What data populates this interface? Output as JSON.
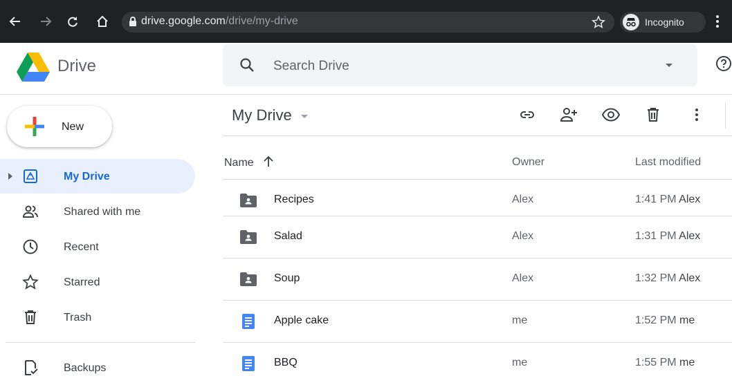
{
  "browser": {
    "url_host": "drive.google.com",
    "url_path": "/drive/my-drive",
    "incognito_label": "Incognito",
    "icons": [
      "back-arrow-icon",
      "forward-arrow-icon",
      "reload-icon",
      "home-icon",
      "lock-icon",
      "star-icon",
      "incognito-icon",
      "more-vert-icon"
    ]
  },
  "header": {
    "brand": "Drive",
    "search_placeholder": "Search Drive"
  },
  "sidebar": {
    "new_label": "New",
    "items": [
      {
        "label": "My Drive",
        "icon": "my-drive-icon",
        "active": true
      },
      {
        "label": "Shared with me",
        "icon": "people-icon"
      },
      {
        "label": "Recent",
        "icon": "clock-icon"
      },
      {
        "label": "Starred",
        "icon": "star-outline-icon"
      },
      {
        "label": "Trash",
        "icon": "trash-icon"
      },
      {
        "label": "Backups",
        "icon": "backups-icon"
      }
    ]
  },
  "main": {
    "title": "My Drive",
    "toolbar_icons": [
      "get-link-icon",
      "share-icon",
      "preview-icon",
      "delete-icon",
      "more-actions-icon"
    ],
    "columns": {
      "name": "Name",
      "owner": "Owner",
      "modified": "Last modified"
    },
    "files": [
      {
        "name": "Recipes",
        "type": "shared-folder",
        "owner": "Alex",
        "modified_time": "1:41 PM",
        "modified_by": "Alex"
      },
      {
        "name": "Salad",
        "type": "shared-folder",
        "owner": "Alex",
        "modified_time": "1:31 PM",
        "modified_by": "Alex"
      },
      {
        "name": "Soup",
        "type": "shared-folder",
        "owner": "Alex",
        "modified_time": "1:32 PM",
        "modified_by": "Alex"
      },
      {
        "name": "Apple cake",
        "type": "document",
        "owner": "me",
        "modified_time": "1:52 PM",
        "modified_by": "me"
      },
      {
        "name": "BBQ",
        "type": "document",
        "owner": "me",
        "modified_time": "1:55 PM",
        "modified_by": "me"
      }
    ]
  },
  "colors": {
    "accent_blue": "#1967d2",
    "doc_blue": "#4285f4",
    "active_bg": "#e8f0fe",
    "folder_gray": "#5f6368",
    "chrome_dark": "#202124"
  }
}
